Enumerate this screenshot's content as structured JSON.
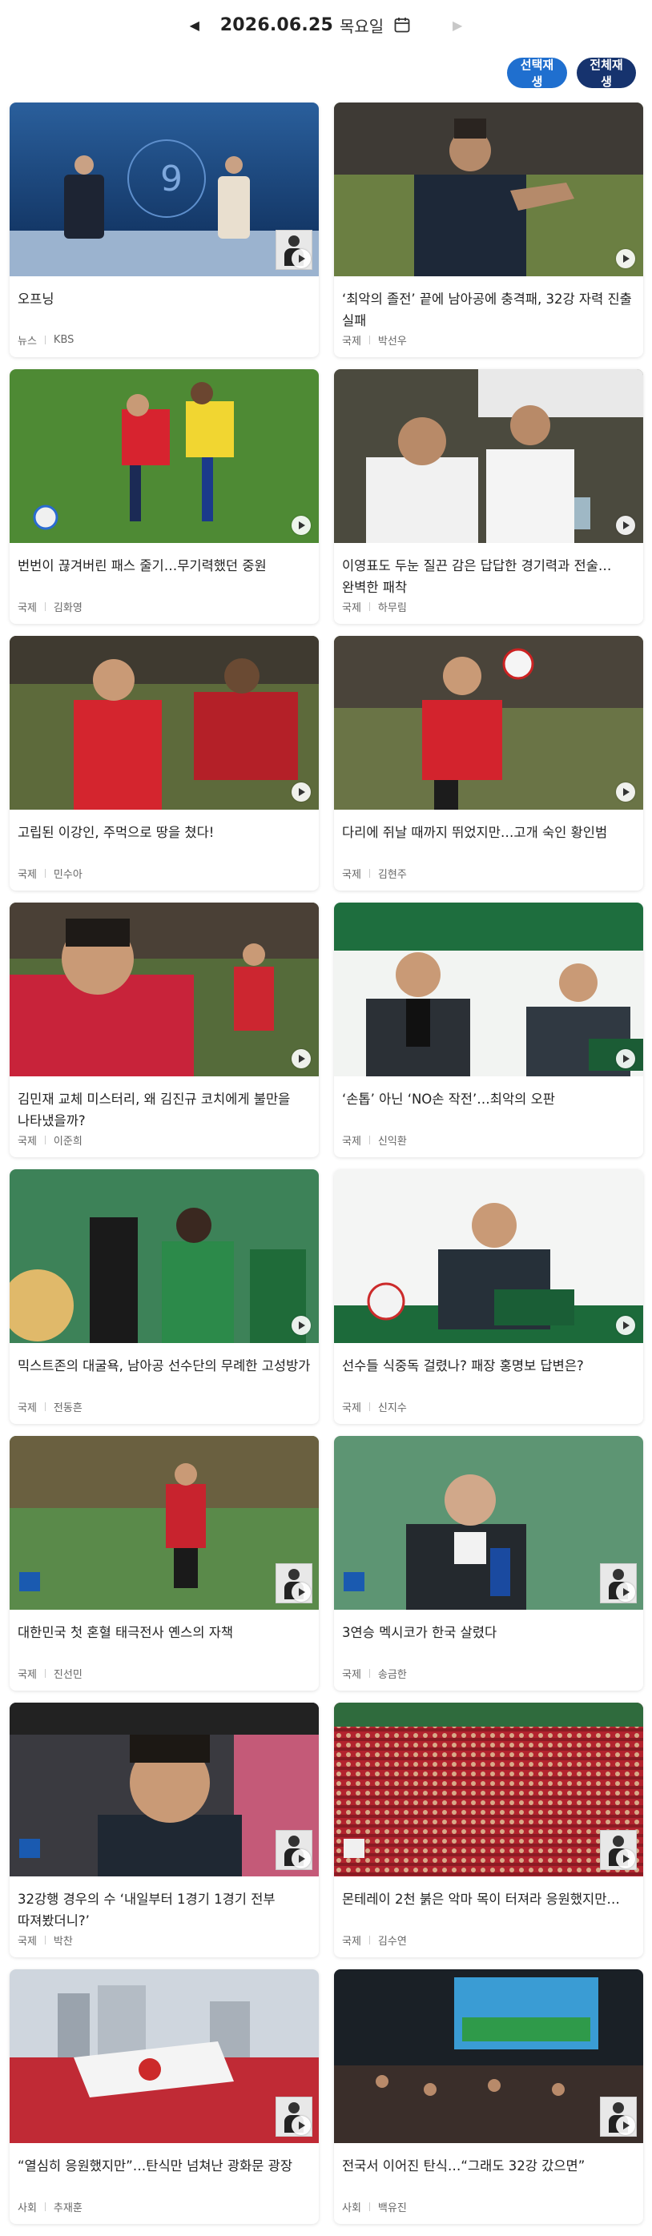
{
  "header": {
    "date": "2026.06.25",
    "weekday": "목요일"
  },
  "toolbar": {
    "select_play": "선택재생",
    "play_all": "전체재생"
  },
  "items": [
    {
      "title": "오프닝",
      "category": "뉴스",
      "reporter": "KBS"
    },
    {
      "title": "‘최악의 졸전’ 끝에 남아공에 충격패, 32강 자력 진출 실패",
      "category": "국제",
      "reporter": "박선우"
    },
    {
      "title": "번번이 끊겨버린 패스 줄기…무기력했던 중원",
      "category": "국제",
      "reporter": "김화영"
    },
    {
      "title": "이영표도 두눈 질끈 감은 답답한 경기력과 전술…완벽한 패착",
      "category": "국제",
      "reporter": "하무림"
    },
    {
      "title": "고립된 이강인, 주먹으로 땅을 쳤다!",
      "category": "국제",
      "reporter": "민수아"
    },
    {
      "title": "다리에 쥐날 때까지 뛰었지만…고개 숙인 황인범",
      "category": "국제",
      "reporter": "김현주"
    },
    {
      "title": "김민재 교체 미스터리, 왜 김진규 코치에게 불만을 나타냈을까?",
      "category": "국제",
      "reporter": "이준희"
    },
    {
      "title": "‘손톱’ 아닌 ‘NO손 작전’…최악의 오판",
      "category": "국제",
      "reporter": "신익환"
    },
    {
      "title": "믹스트존의 대굴욕, 남아공 선수단의 무례한 고성방가",
      "category": "국제",
      "reporter": "전동흔"
    },
    {
      "title": "선수들 식중독 걸렸나? 패장 홍명보 답변은?",
      "category": "국제",
      "reporter": "신지수"
    },
    {
      "title": "대한민국 첫 혼혈 태극전사 옌스의 자책",
      "category": "국제",
      "reporter": "진선민"
    },
    {
      "title": "3연승 멕시코가 한국 살렸다",
      "category": "국제",
      "reporter": "송금한"
    },
    {
      "title": "32강행 경우의 수 ‘내일부터 1경기 1경기 전부 따져봤더니?’",
      "category": "국제",
      "reporter": "박찬"
    },
    {
      "title": "몬테레이 2천 붉은 악마 목이 터져라 응원했지만…",
      "category": "국제",
      "reporter": "김수연"
    },
    {
      "title": "“열심히 응원했지만”…탄식만 넘쳐난 광화문 광장",
      "category": "사회",
      "reporter": "추재훈"
    },
    {
      "title": "전국서 이어진 탄식…“그래도 32강 갔으면”",
      "category": "사회",
      "reporter": "백유진"
    }
  ]
}
